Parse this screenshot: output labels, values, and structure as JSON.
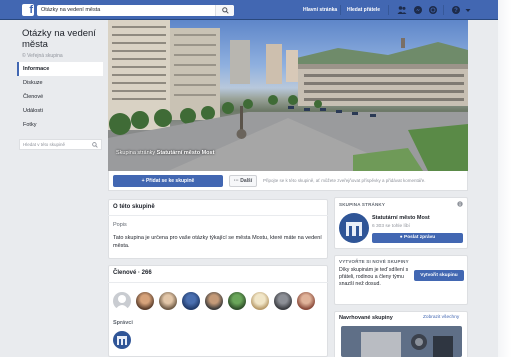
{
  "topbar": {
    "search_value": "Otázky na vedení města",
    "home_link": "Hlavní stránka",
    "find_friends_link": "Hledat přátele"
  },
  "group": {
    "title": "Otázky na vedení města",
    "privacy": "Veřejná skupina",
    "nav": [
      "Informace",
      "Diskuze",
      "Členové",
      "Události",
      "Fotky"
    ],
    "search_placeholder": "Hledat v této skupině"
  },
  "cover": {
    "caption_prefix": "Skupina stránky",
    "caption_page": "Statutární město Most"
  },
  "actions": {
    "join_label": "+ Přidat se ke skupině",
    "more_label": "··· Další",
    "note": "Připojte se k této skupině, ať můžete zveřejňovat příspěvky a přidávat komentáře."
  },
  "about": {
    "heading": "O této skupině",
    "desc_label": "Popis",
    "desc_text": "Tato skupina je určena pro vaše otázky týkající se města Mostu, které máte na vedení města."
  },
  "members": {
    "heading": "Členové · 266",
    "admins_label": "Správci"
  },
  "owner_card": {
    "heading": "SKUPINA STRÁNKY",
    "page_name": "Statutární město Most",
    "likes": "6 303 se tohle líbí",
    "message_btn": "Poslat zprávu"
  },
  "create_card": {
    "heading": "VYTVOŘTE SI NOVÉ SKUPINY",
    "text": "Díky skupinám je teď sdílení s přáteli, rodinou a členy týmu snazší než dosud.",
    "button": "Vytvořit skupinu"
  },
  "suggested": {
    "heading": "Navrhované skupiny",
    "see_all": "Zobrazit všechny"
  }
}
